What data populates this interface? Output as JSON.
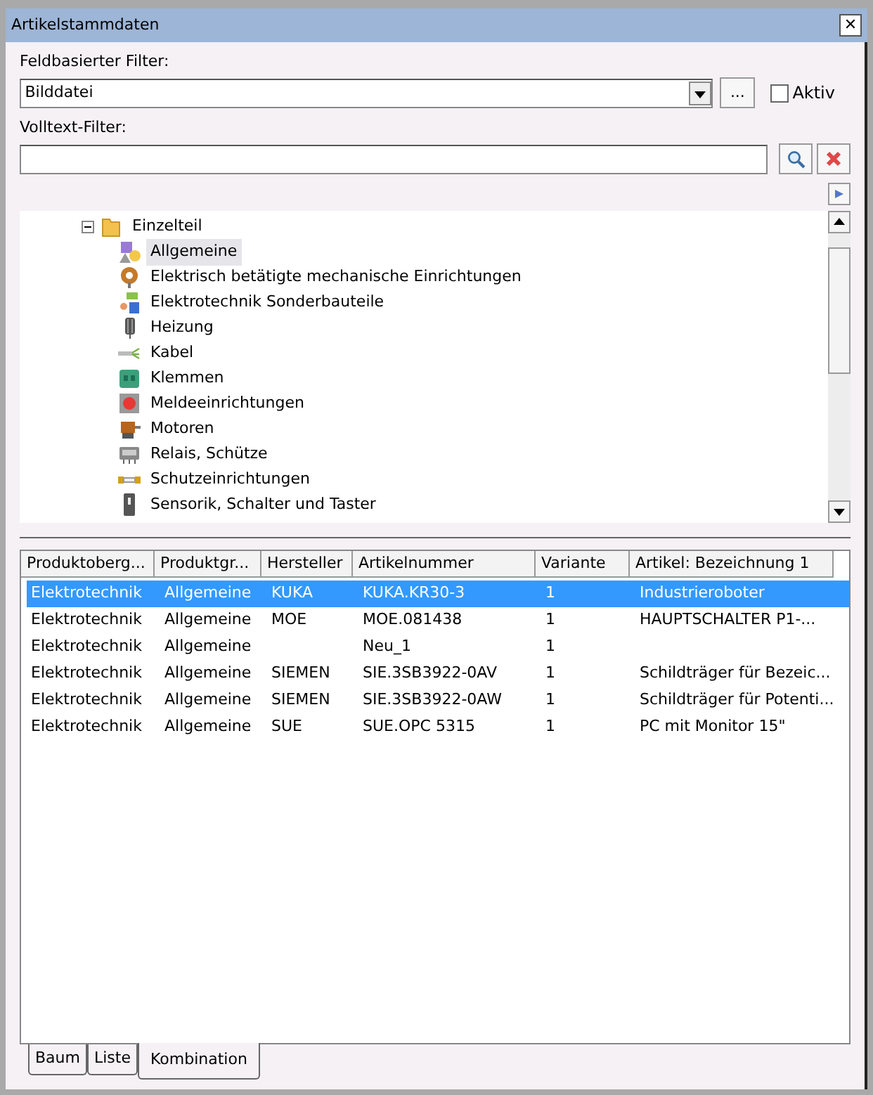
{
  "window": {
    "title": "Artikelstammdaten",
    "close": "✕"
  },
  "field_filter": {
    "label": "Feldbasierter Filter:",
    "value": "Bilddatei",
    "more_button": "...",
    "aktiv": {
      "label": "Aktiv",
      "checked": false
    }
  },
  "fulltext_filter": {
    "label": "Volltext-Filter:"
  },
  "tree": {
    "label": "Einzelteil",
    "expanded": true,
    "children": [
      {
        "label": "Allgemeine",
        "selected": true
      },
      {
        "label": "Elektrisch betätigte mechanische Einrichtungen",
        "selected": false
      },
      {
        "label": "Elektrotechnik Sonderbauteile",
        "selected": false
      },
      {
        "label": "Heizung",
        "selected": false
      },
      {
        "label": "Kabel",
        "selected": false
      },
      {
        "label": "Klemmen",
        "selected": false
      },
      {
        "label": "Meldeeinrichtungen",
        "selected": false
      },
      {
        "label": "Motoren",
        "selected": false
      },
      {
        "label": "Relais, Schütze",
        "selected": false
      },
      {
        "label": "Schutzeinrichtungen",
        "selected": false
      },
      {
        "label": "Sensorik, Schalter und Taster",
        "selected": false
      }
    ]
  },
  "table": {
    "columns": [
      "Produktoberg...",
      "Produktgr...",
      "Hersteller",
      "Artikelnummer",
      "Variante",
      "Artikel: Bezeichnung 1"
    ],
    "rows": [
      {
        "selected": true,
        "cells": [
          "Elektrotechnik",
          "Allgemeine",
          "KUKA",
          "KUKA.KR30-3",
          "1",
          "Industrieroboter"
        ]
      },
      {
        "selected": false,
        "cells": [
          "Elektrotechnik",
          "Allgemeine",
          "MOE",
          "MOE.081438",
          "1",
          "HAUPTSCHALTER P1-..."
        ]
      },
      {
        "selected": false,
        "cells": [
          "Elektrotechnik",
          "Allgemeine",
          "",
          "Neu_1",
          "1",
          ""
        ]
      },
      {
        "selected": false,
        "cells": [
          "Elektrotechnik",
          "Allgemeine",
          "SIEMEN",
          "SIE.3SB3922-0AV",
          "1",
          "Schildträger für Bezeic..."
        ]
      },
      {
        "selected": false,
        "cells": [
          "Elektrotechnik",
          "Allgemeine",
          "SIEMEN",
          "SIE.3SB3922-0AW",
          "1",
          "Schildträger für Potenti..."
        ]
      },
      {
        "selected": false,
        "cells": [
          "Elektrotechnik",
          "Allgemeine",
          "SUE",
          "SUE.OPC 5315",
          "1",
          "PC mit Monitor 15\""
        ]
      }
    ]
  },
  "tabs": [
    {
      "label": "Baum",
      "selected": false
    },
    {
      "label": "Liste",
      "selected": false
    },
    {
      "label": "Kombination",
      "selected": true
    }
  ]
}
